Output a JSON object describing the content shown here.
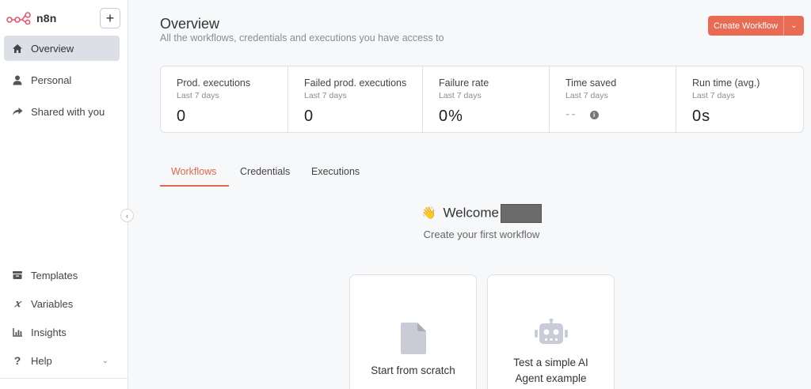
{
  "brand": {
    "name": "n8n"
  },
  "sidebar": {
    "add_label": "+",
    "items": [
      {
        "label": "Overview"
      },
      {
        "label": "Personal"
      },
      {
        "label": "Shared with you"
      }
    ],
    "bottom_items": [
      {
        "label": "Templates"
      },
      {
        "label": "Variables"
      },
      {
        "label": "Insights"
      },
      {
        "label": "Help"
      }
    ]
  },
  "header": {
    "title": "Overview",
    "subtitle": "All the workflows, credentials and executions you have access to",
    "create_button": "Create Workflow"
  },
  "stats": [
    {
      "label": "Prod. executions",
      "period": "Last 7 days",
      "value": "0"
    },
    {
      "label": "Failed prod. executions",
      "period": "Last 7 days",
      "value": "0"
    },
    {
      "label": "Failure rate",
      "period": "Last 7 days",
      "value": "0%"
    },
    {
      "label": "Time saved",
      "period": "Last 7 days",
      "value": "--"
    },
    {
      "label": "Run time (avg.)",
      "period": "Last 7 days",
      "value": "0s"
    }
  ],
  "tabs": [
    {
      "label": "Workflows",
      "active": true
    },
    {
      "label": "Credentials",
      "active": false
    },
    {
      "label": "Executions",
      "active": false
    }
  ],
  "empty_state": {
    "welcome": "Welcome",
    "wave_emoji": "👋",
    "subtitle": "Create your first workflow",
    "cards": [
      {
        "label": "Start from scratch",
        "icon": "file-icon"
      },
      {
        "label": "Test a simple AI Agent example",
        "icon": "robot-icon"
      }
    ]
  },
  "colors": {
    "accent": "#ea6b53",
    "active_nav": "#dcdfe6"
  }
}
